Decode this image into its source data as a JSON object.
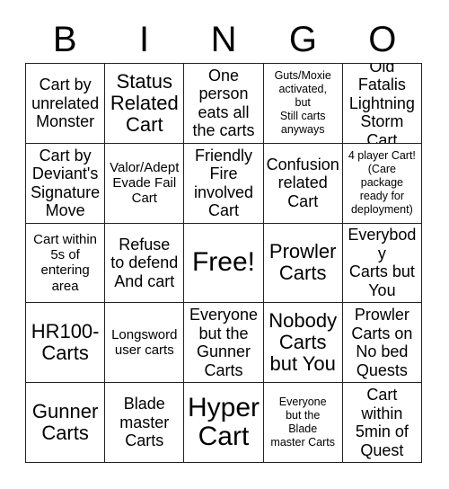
{
  "header": {
    "letters": [
      "B",
      "I",
      "N",
      "G",
      "O"
    ]
  },
  "grid": {
    "columns": 5,
    "rows": 5,
    "border_color": "#222222",
    "background_color": "#ffffff",
    "text_color": "#000000"
  },
  "cells": [
    {
      "id": "b1",
      "text": "Cart by\nunrelated\nMonster",
      "size": "md"
    },
    {
      "id": "i1",
      "text": "Status\nRelated\nCart",
      "size": "lg"
    },
    {
      "id": "n1",
      "text": "One\nperson\neats all\nthe carts",
      "size": "md"
    },
    {
      "id": "g1",
      "text": "Guts/Moxie\nactivated,\nbut\nStill carts\nanyways",
      "size": "xs"
    },
    {
      "id": "o1",
      "text": "Old Fatalis\nLightning\nStorm\nCart",
      "size": "md"
    },
    {
      "id": "b2",
      "text": "Cart by\nDeviant's\nSignature\nMove",
      "size": "md"
    },
    {
      "id": "i2",
      "text": "Valor/Adept\nEvade Fail\nCart",
      "size": "sm"
    },
    {
      "id": "n2",
      "text": "Friendly\nFire\ninvolved\nCart",
      "size": "md"
    },
    {
      "id": "g2",
      "text": "Confusion\nrelated\nCart",
      "size": "md"
    },
    {
      "id": "o2",
      "text": "4 player Cart!\n(Care\npackage\nready for\ndeployment)",
      "size": "xs"
    },
    {
      "id": "b3",
      "text": "Cart within\n5s of\nentering\narea",
      "size": "sm"
    },
    {
      "id": "i3",
      "text": "Refuse\nto defend\nAnd cart",
      "size": "md"
    },
    {
      "id": "n3",
      "text": "Free!",
      "size": "xl"
    },
    {
      "id": "g3",
      "text": "Prowler\nCarts",
      "size": "lg"
    },
    {
      "id": "o3",
      "text": "Everybody\nCarts but\nYou",
      "size": "md"
    },
    {
      "id": "b4",
      "text": "HR100-\nCarts",
      "size": "lg"
    },
    {
      "id": "i4",
      "text": "Longsword\nuser carts",
      "size": "sm"
    },
    {
      "id": "n4",
      "text": "Everyone\nbut the\nGunner\nCarts",
      "size": "md"
    },
    {
      "id": "g4",
      "text": "Nobody\nCarts\nbut You",
      "size": "lg"
    },
    {
      "id": "o4",
      "text": "Prowler\nCarts on\nNo bed\nQuests",
      "size": "md"
    },
    {
      "id": "b5",
      "text": "Gunner\nCarts",
      "size": "lg"
    },
    {
      "id": "i5",
      "text": "Blade\nmaster\nCarts",
      "size": "md"
    },
    {
      "id": "n5",
      "text": "Hyper\nCart",
      "size": "xl"
    },
    {
      "id": "g5",
      "text": "Everyone\nbut the\nBlade\nmaster Carts",
      "size": "xs"
    },
    {
      "id": "o5",
      "text": "Cart\nwithin\n5min of\nQuest",
      "size": "md"
    }
  ]
}
